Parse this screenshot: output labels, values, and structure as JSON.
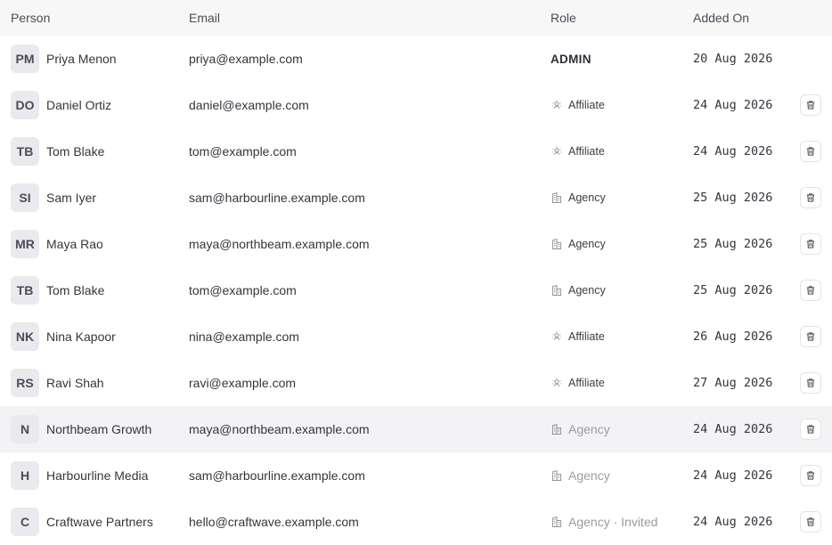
{
  "table": {
    "headers": {
      "person": "Person",
      "email": "Email",
      "role": "Role",
      "added_on": "Added On"
    },
    "rows": [
      {
        "initials": "PM",
        "name": "Priya Menon",
        "email": "priya@example.com",
        "role": "ADMIN",
        "role_type": "admin",
        "added": "20 Aug 2026",
        "deletable": false,
        "highlighted": false
      },
      {
        "initials": "DO",
        "name": "Daniel Ortiz",
        "email": "daniel@example.com",
        "role": "Affiliate",
        "role_type": "affiliate",
        "added": "24 Aug 2026",
        "deletable": true,
        "highlighted": false
      },
      {
        "initials": "TB",
        "name": "Tom Blake",
        "email": "tom@example.com",
        "role": "Affiliate",
        "role_type": "affiliate",
        "added": "24 Aug 2026",
        "deletable": true,
        "highlighted": false
      },
      {
        "initials": "SI",
        "name": "Sam Iyer",
        "email": "sam@harbourline.example.com",
        "role": "Agency",
        "role_type": "agency",
        "added": "25 Aug 2026",
        "deletable": true,
        "highlighted": false
      },
      {
        "initials": "MR",
        "name": "Maya Rao",
        "email": "maya@northbeam.example.com",
        "role": "Agency",
        "role_type": "agency",
        "added": "25 Aug 2026",
        "deletable": true,
        "highlighted": false
      },
      {
        "initials": "TB",
        "name": "Tom Blake",
        "email": "tom@example.com",
        "role": "Agency",
        "role_type": "agency",
        "added": "25 Aug 2026",
        "deletable": true,
        "highlighted": false
      },
      {
        "initials": "NK",
        "name": "Nina Kapoor",
        "email": "nina@example.com",
        "role": "Affiliate",
        "role_type": "affiliate",
        "added": "26 Aug 2026",
        "deletable": true,
        "highlighted": false
      },
      {
        "initials": "RS",
        "name": "Ravi Shah",
        "email": "ravi@example.com",
        "role": "Affiliate",
        "role_type": "affiliate",
        "added": "27 Aug 2026",
        "deletable": true,
        "highlighted": false
      },
      {
        "initials": "N",
        "name": "Northbeam Growth",
        "email": "maya@northbeam.example.com",
        "role": "Agency",
        "role_type": "agency-org",
        "added": "24 Aug 2026",
        "deletable": true,
        "highlighted": true
      },
      {
        "initials": "H",
        "name": "Harbourline Media",
        "email": "sam@harbourline.example.com",
        "role": "Agency",
        "role_type": "agency-org",
        "added": "24 Aug 2026",
        "deletable": true,
        "highlighted": false
      },
      {
        "initials": "C",
        "name": "Craftwave Partners",
        "email": "hello@craftwave.example.com",
        "role": "Agency · Invited",
        "role_type": "agency-org",
        "added": "24 Aug 2026",
        "deletable": true,
        "highlighted": false
      }
    ]
  },
  "icons": {
    "affiliate": "affiliate-icon",
    "agency": "building-icon",
    "delete": "trash-icon"
  },
  "colors": {
    "header_bg": "#f7f7f8",
    "avatar_bg": "#eaeaee",
    "highlight_bg": "#f3f3f5",
    "muted_text": "#9a9ca3"
  }
}
